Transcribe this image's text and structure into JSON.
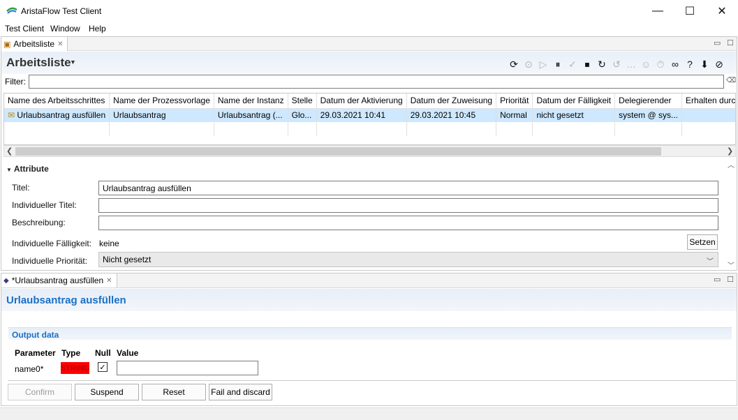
{
  "window": {
    "title": "AristaFlow Test Client",
    "minimize": "—",
    "maximize": "☐",
    "close": "✕"
  },
  "menu": [
    "Test Client",
    "Window",
    "Help"
  ],
  "worklist_view": {
    "tab_label": "Arbeitsliste",
    "title": "Arbeitsliste",
    "filter_label": "Filter:",
    "filter_value": "",
    "columns": [
      "Name des Arbeitsschrittes",
      "Name der Prozessvorlage",
      "Name der Instanz",
      "Stelle",
      "Datum der Aktivierung",
      "Datum der Zuweisung",
      "Priorität",
      "Datum der Fälligkeit",
      "Delegierender",
      "Erhalten durch"
    ],
    "rows": [
      [
        "Urlaubsantrag ausfüllen",
        "Urlaubsantrag",
        "Urlaubsantrag (...",
        "Glo...",
        "29.03.2021 10:41",
        "29.03.2021 10:45",
        "Normal",
        "nicht gesetzt",
        "system @ sys...",
        ""
      ]
    ],
    "toolbar_icons": [
      "refresh-icon",
      "down-circle-icon",
      "play-circle-icon",
      "pause-circle-icon",
      "check-circle-icon",
      "stop-circle-icon",
      "redo-circle-icon",
      "undo-circle-icon",
      "chat-icon",
      "chat-users-icon",
      "timer-icon",
      "link-icon",
      "help-circle-icon",
      "download-circle-icon",
      "cancel-circle-icon"
    ]
  },
  "attributes": {
    "header": "Attribute",
    "title_label": "Titel:",
    "title_value": "Urlaubsantrag ausfüllen",
    "custom_title_label": "Individueller Titel:",
    "custom_title_value": "",
    "description_label": "Beschreibung:",
    "description_value": "",
    "due_label": "Individuelle Fälligkeit:",
    "due_value": "keine",
    "set_button": "Setzen",
    "priority_label": "Individuelle Priorität:",
    "priority_value": "Nicht gesetzt"
  },
  "form_view": {
    "tab_label": "*Urlaubsantrag ausfüllen",
    "title": "Urlaubsantrag ausfüllen",
    "section": "Output data",
    "columns": {
      "parameter": "Parameter",
      "type": "Type",
      "null": "Null",
      "value": "Value"
    },
    "param": {
      "name": "name0*",
      "type": "STRING",
      "null_checked": true,
      "value": ""
    },
    "buttons": {
      "confirm": "Confirm",
      "suspend": "Suspend",
      "reset": "Reset",
      "fail": "Fail and discard"
    }
  },
  "colors": {
    "accent": "#1a6fc4",
    "selection": "#cde8ff",
    "type_badge": "#ff0000"
  }
}
